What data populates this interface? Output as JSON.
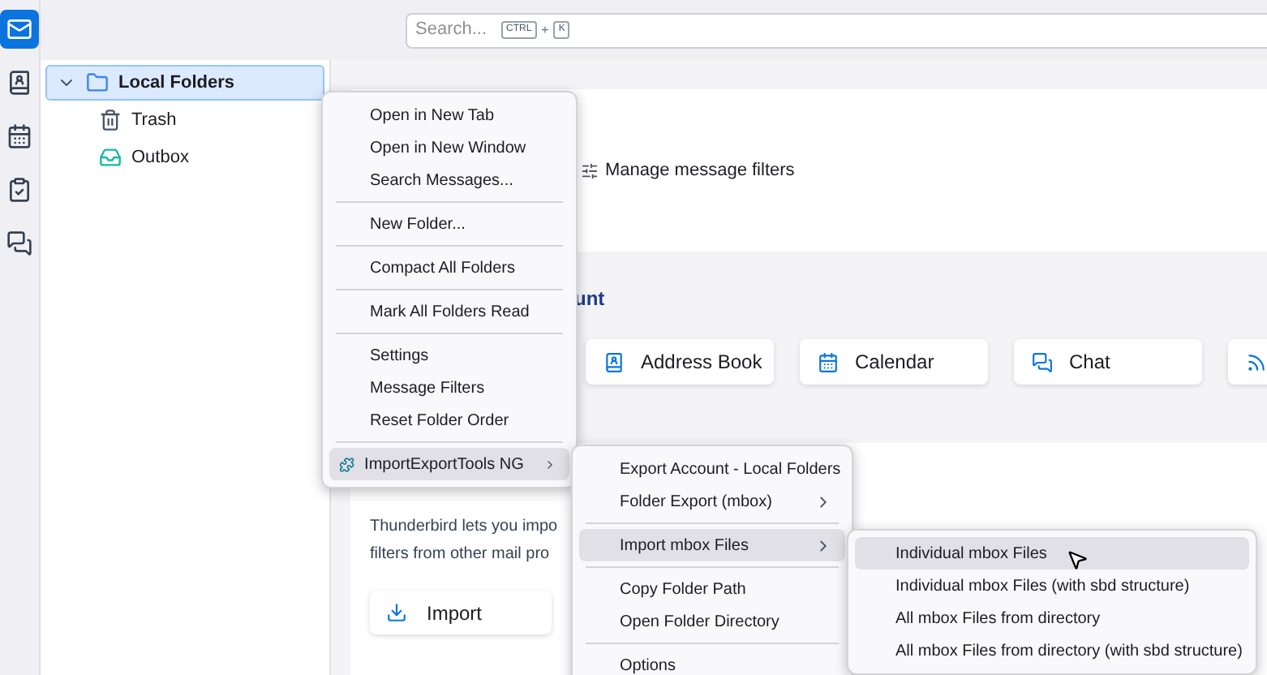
{
  "spaces": [
    {
      "kind": "mail",
      "selected": true
    },
    {
      "kind": "contacts",
      "selected": false
    },
    {
      "kind": "calendar",
      "selected": false
    },
    {
      "kind": "tasks",
      "selected": false
    },
    {
      "kind": "chat",
      "selected": false
    }
  ],
  "search": {
    "placeholder": "Search...",
    "keys": [
      "CTRL",
      "K"
    ],
    "joiner": "+"
  },
  "folders": [
    {
      "name": "Local Folders",
      "kind": "account",
      "selected": true,
      "expanded": true,
      "children": [
        {
          "name": "Trash",
          "kind": "trash",
          "selected": false
        },
        {
          "name": "Outbox",
          "kind": "outbox",
          "selected": false
        }
      ]
    }
  ],
  "main": {
    "filters_link": "Manage message filters",
    "heading": "unt",
    "cards": [
      {
        "label": "Address Book",
        "kind": "contacts"
      },
      {
        "label": "Calendar",
        "kind": "calendar"
      },
      {
        "label": "Chat",
        "kind": "chat"
      },
      {
        "kind": "feed"
      }
    ],
    "import_text": [
      "Thunderbird lets you impo",
      "filters from other mail pro"
    ],
    "import_button": "Import"
  },
  "context_menu": [
    {
      "kind": "item",
      "label": "Open in New Tab",
      "selected": false
    },
    {
      "kind": "item",
      "label": "Open in New Window",
      "selected": false
    },
    {
      "kind": "item",
      "label": "Search Messages...",
      "selected": false
    },
    {
      "kind": "separator"
    },
    {
      "kind": "item",
      "label": "New Folder...",
      "selected": false
    },
    {
      "kind": "separator"
    },
    {
      "kind": "item",
      "label": "Compact All Folders",
      "selected": false
    },
    {
      "kind": "separator"
    },
    {
      "kind": "item",
      "label": "Mark All Folders Read",
      "selected": false
    },
    {
      "kind": "separator"
    },
    {
      "kind": "item",
      "label": "Settings",
      "selected": false
    },
    {
      "kind": "item",
      "label": "Message Filters",
      "selected": false
    },
    {
      "kind": "item",
      "label": "Reset Folder Order",
      "selected": false
    },
    {
      "kind": "separator"
    },
    {
      "kind": "item",
      "label": "ImportExportTools NG",
      "selected": true,
      "has_submenu": true,
      "icon": true
    }
  ],
  "submenu": [
    {
      "kind": "item",
      "label": "Export Account - Local Folders",
      "selected": false
    },
    {
      "kind": "item",
      "label": "Folder Export (mbox)",
      "selected": false,
      "has_submenu": true
    },
    {
      "kind": "separator"
    },
    {
      "kind": "item",
      "label": "Import mbox Files",
      "selected": true,
      "has_submenu": true
    },
    {
      "kind": "separator"
    },
    {
      "kind": "item",
      "label": "Copy Folder Path",
      "selected": false
    },
    {
      "kind": "item",
      "label": "Open Folder Directory",
      "selected": false
    },
    {
      "kind": "separator"
    },
    {
      "kind": "item",
      "label": "Options",
      "selected": false
    }
  ],
  "submenu_2": [
    {
      "kind": "item",
      "label": "Individual mbox Files",
      "selected": true
    },
    {
      "kind": "item",
      "label": "Individual mbox Files (with sbd structure)",
      "selected": false
    },
    {
      "kind": "item",
      "label": "All mbox Files from directory",
      "selected": false
    },
    {
      "kind": "item",
      "label": "All mbox Files from directory (with sbd structure)",
      "selected": false
    }
  ]
}
